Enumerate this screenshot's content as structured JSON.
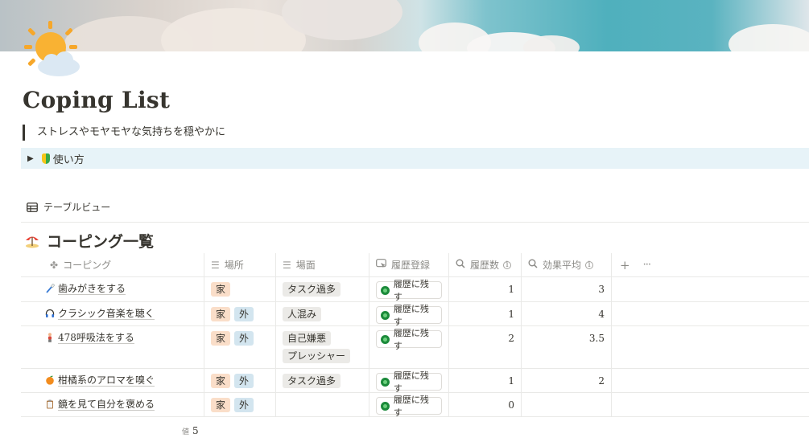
{
  "page": {
    "title": "Coping List",
    "quote": "ストレスやモヤモヤな気持ちを穏やかに",
    "toggle_label": "使い方",
    "page_icon": "sun-behind-cloud-icon"
  },
  "view": {
    "tab_label": "テーブルビュー",
    "tab_icon": "table-icon"
  },
  "database": {
    "title": "コーピング一覧",
    "title_icon": "beach-umbrella-icon",
    "columns": [
      {
        "label": "コーピング",
        "icon": "clover-icon"
      },
      {
        "label": "場所",
        "icon": "list-icon"
      },
      {
        "label": "場面",
        "icon": "list-icon"
      },
      {
        "label": "履歴登録",
        "icon": "button-icon"
      },
      {
        "label": "履歴数",
        "icon": "search-icon"
      },
      {
        "label": "効果平均",
        "icon": "search-icon"
      }
    ],
    "add_column_label": "+",
    "more_label": "···",
    "button_label": "履歴に残す",
    "rows": [
      {
        "name": "歯みがきをする",
        "icon": "toothbrush-icon",
        "places": [
          "家"
        ],
        "scenes": [
          "タスク過多"
        ],
        "count": "1",
        "avg": "3"
      },
      {
        "name": "クラシック音楽を聴く",
        "icon": "headphones-icon",
        "places": [
          "家",
          "外"
        ],
        "scenes": [
          "人混み"
        ],
        "count": "1",
        "avg": "4"
      },
      {
        "name": "478呼吸法をする",
        "icon": "person-icon",
        "places": [
          "家",
          "外"
        ],
        "scenes": [
          "自己嫌悪",
          "プレッシャー"
        ],
        "count": "2",
        "avg": "3.5"
      },
      {
        "name": "柑橘系のアロマを嗅ぐ",
        "icon": "tangerine-icon",
        "places": [
          "家",
          "外"
        ],
        "scenes": [
          "タスク過多"
        ],
        "count": "1",
        "avg": "2"
      },
      {
        "name": "鏡を見て自分を褒める",
        "icon": "clipboard-icon",
        "places": [
          "家",
          "外"
        ],
        "scenes": [],
        "count": "0",
        "avg": ""
      }
    ],
    "footer_label": "値",
    "footer_value": "5"
  },
  "colors": {
    "place_home": "#fadec9",
    "place_out": "#d3e5ef",
    "scene": "#ebeae7",
    "toggle_bg": "#e7f3f8"
  }
}
